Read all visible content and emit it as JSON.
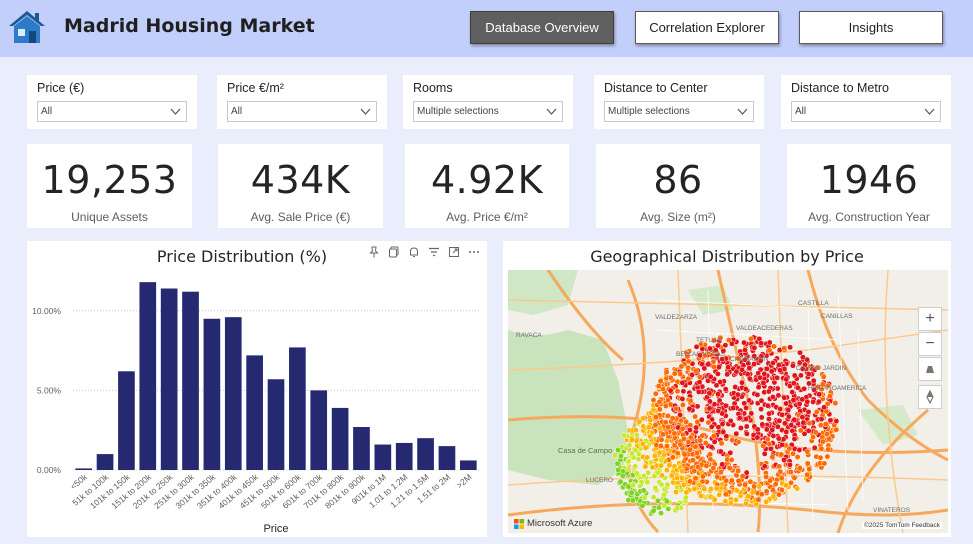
{
  "header": {
    "title": "Madrid Housing Market",
    "nav": [
      {
        "label": "Database Overview",
        "active": true
      },
      {
        "label": "Correlation Explorer",
        "active": false
      },
      {
        "label": "Insights",
        "active": false
      }
    ]
  },
  "filters": [
    {
      "label": "Price (€)",
      "value": "All"
    },
    {
      "label": "Price €/m²",
      "value": "All"
    },
    {
      "label": "Rooms",
      "value": "Multiple selections"
    },
    {
      "label": "Distance to Center",
      "value": "Multiple selections"
    },
    {
      "label": "Distance to Metro",
      "value": "All"
    }
  ],
  "kpis": [
    {
      "value": "19,253",
      "label": "Unique Assets"
    },
    {
      "value": "434K",
      "label": "Avg. Sale Price (€)"
    },
    {
      "value": "4.92K",
      "label": "Avg. Price €/m²"
    },
    {
      "value": "86",
      "label": "Avg. Size (m²)"
    },
    {
      "value": "1946",
      "label": "Avg. Construction Year"
    }
  ],
  "price_chart": {
    "title": "Price Distribution (%)"
  },
  "map_panel": {
    "title": "Geographical Distribution by Price",
    "attribution_left": "Microsoft Azure",
    "attribution_right": "©2025 TomTom  Feedback",
    "place_labels": [
      "VALDEZARZA",
      "BELLAS VISTAS",
      "CHAMARTIN",
      "CIUDAD JARDIN",
      "CASTILLA",
      "CANILLAS",
      "VALDEACEDERAS",
      "TETUAN",
      "HISPANOAMERICA",
      "RAVACA",
      "Casa de Campo",
      "LUCERO",
      "VINATEROS"
    ],
    "controls": [
      "+",
      "−"
    ],
    "colors": {
      "high": "#e0151b",
      "mid_high": "#ff6a00",
      "mid": "#ffb300",
      "low": "#c8e82a",
      "lowest": "#7ed321"
    }
  },
  "chart_data": {
    "type": "bar",
    "title": "Price Distribution (%)",
    "xlabel": "Price",
    "ylabel": "",
    "categories": [
      "<50k",
      "51k to 100k",
      "101k to 150k",
      "151k to 200k",
      "201k to 250k",
      "251k to 300k",
      "301k to 350k",
      "351k to 400k",
      "401k to 450k",
      "451k to 500k",
      "501k to 600k",
      "601k to 700k",
      "701k to 800k",
      "801k to 900k",
      "901k to 1M",
      "1.01 to 1.2M",
      "1.21 to 1.5M",
      "1.51 to 2M",
      ">2M"
    ],
    "values": [
      0.1,
      1.0,
      6.2,
      11.8,
      11.4,
      11.2,
      9.5,
      9.6,
      7.2,
      5.7,
      7.7,
      5.0,
      3.9,
      2.7,
      1.6,
      1.7,
      2.0,
      1.5,
      0.6
    ],
    "ylim": [
      0,
      12.5
    ],
    "yticks": [
      "0.00%",
      "5.00%",
      "10.00%"
    ],
    "ytick_values": [
      0,
      5,
      10
    ],
    "bar_color": "#252970",
    "grid": true
  }
}
